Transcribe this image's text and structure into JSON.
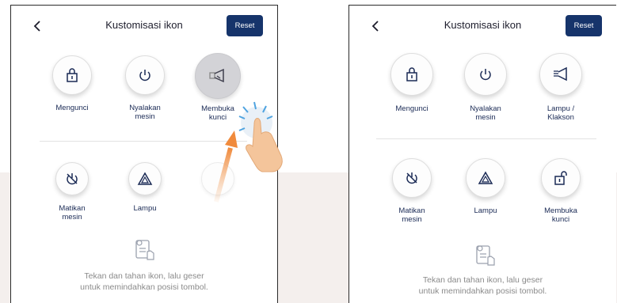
{
  "accent_color": "#16346b",
  "left_screen": {
    "title": "Kustomisasi ikon",
    "reset_label": "Reset",
    "row1": [
      {
        "label": "Mengunci",
        "icon": "lock-icon"
      },
      {
        "label": "Nyalakan\nmesin",
        "icon": "power-icon"
      },
      {
        "label": "Membuka\nkunci",
        "icon": "horn-lamp-icon"
      }
    ],
    "row2": [
      {
        "label": "Matikan\nmesin",
        "icon": "power-off-icon"
      },
      {
        "label": "Lampu",
        "icon": "hazard-icon"
      }
    ],
    "hint": "Tekan dan tahan ikon, lalu geser\nuntuk memindahkan posisi tombol."
  },
  "right_screen": {
    "title": "Kustomisasi ikon",
    "reset_label": "Reset",
    "row1": [
      {
        "label": "Mengunci",
        "icon": "lock-icon"
      },
      {
        "label": "Nyalakan\nmesin",
        "icon": "power-icon"
      },
      {
        "label": "Lampu /\nKlakson",
        "icon": "horn-lamp-icon"
      }
    ],
    "row2": [
      {
        "label": "Matikan\nmesin",
        "icon": "power-off-icon"
      },
      {
        "label": "Lampu",
        "icon": "hazard-icon"
      },
      {
        "label": "Membuka\nkunci",
        "icon": "unlock-icon"
      }
    ],
    "hint": "Tekan dan tahan ikon, lalu geser\nuntuk memindahkan posisi tombol."
  }
}
